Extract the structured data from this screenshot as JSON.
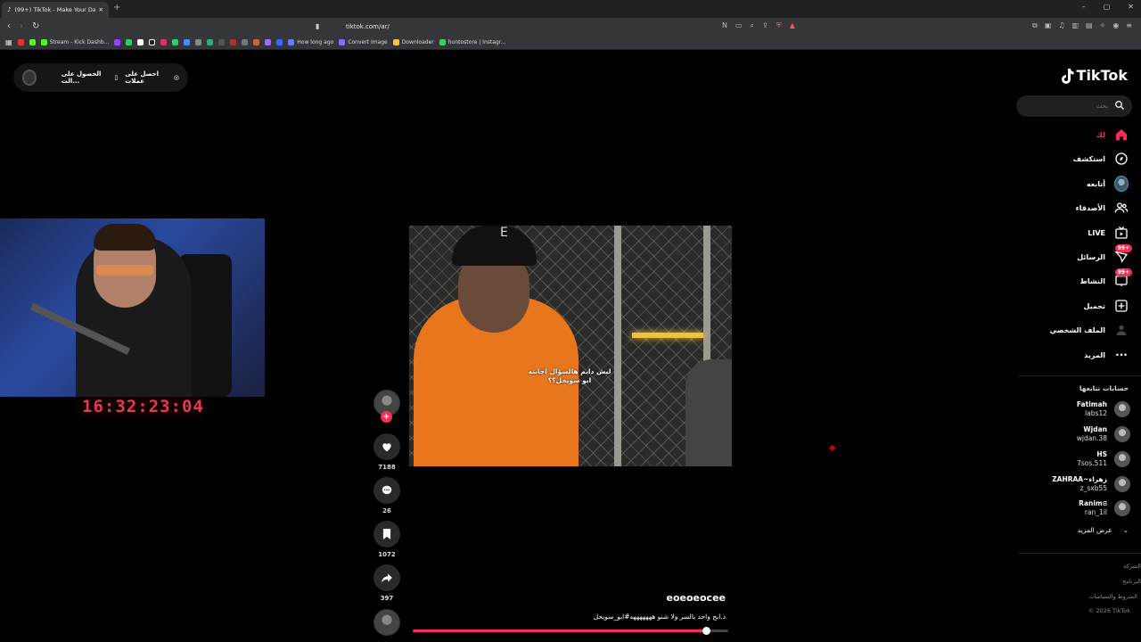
{
  "browser": {
    "tab_title": "(99+) TikTok - Make Your Day",
    "url": "tiktok.com/ar/",
    "bookmarks": [
      {
        "label": "Stream - Kick Dashb...",
        "color": "#53fc18"
      },
      {
        "label": "How long ago",
        "color": "#6a7cff"
      },
      {
        "label": "Convert Image",
        "color": "#8a6aff"
      },
      {
        "label": "Downloader",
        "color": "#f5c542"
      },
      {
        "label": "huntostore | Instagr...",
        "color": "#2bd46a"
      }
    ]
  },
  "top_pill": {
    "item1": "احصل على عملات",
    "item2": "الحصول على الت..."
  },
  "stream_overlay": {
    "timer": "16:32:23:04"
  },
  "video": {
    "subtitle_line1": "ليش دايم هالسؤال اجابته",
    "subtitle_line2": "ابو سويحل؟؟",
    "author": "eoeoeocee",
    "description": "ذ.ابح واحد بالسر ولا شنو هههههههه#ابو_سويحل",
    "progress_fraction": 0.93,
    "likes": "7188",
    "comments": "26",
    "saves": "1072",
    "shares": "397"
  },
  "sidebar": {
    "logo": "TikTok",
    "search_placeholder": "بحث",
    "nav": [
      {
        "label": "لك",
        "icon": "home-icon"
      },
      {
        "label": "استكشف",
        "icon": "compass-icon"
      },
      {
        "label": "أتابعه",
        "icon": "following-avatar"
      },
      {
        "label": "الأصدقاء",
        "icon": "friends-icon"
      },
      {
        "label": "LIVE",
        "icon": "live-icon"
      },
      {
        "label": "الرسائل",
        "icon": "messages-icon",
        "badge": "99+"
      },
      {
        "label": "النشاط",
        "icon": "activity-icon",
        "badge": "99+"
      },
      {
        "label": "تحميل",
        "icon": "upload-icon"
      },
      {
        "label": "الملف الشخصي",
        "icon": "profile-icon"
      },
      {
        "label": "المزيد",
        "icon": "more-icon"
      }
    ],
    "following_header": "حسابات تتابعها",
    "following": [
      {
        "name": "Fatimah",
        "handle": "labs12"
      },
      {
        "name": "Wjdan",
        "handle": "wjdan.38"
      },
      {
        "name": "HS",
        "handle": "7sos.511"
      },
      {
        "name": "ZAHRAA~زهراء",
        "handle": "z_sxb55"
      },
      {
        "name": "Ranim𝔖",
        "handle": "ran_1il"
      }
    ],
    "see_more": "عرض المزيد",
    "footer": [
      "الشركة",
      "البرنامج",
      "الشروط والسياسات",
      "© 2026 TikTok"
    ],
    "accent": "#fe2c55"
  }
}
